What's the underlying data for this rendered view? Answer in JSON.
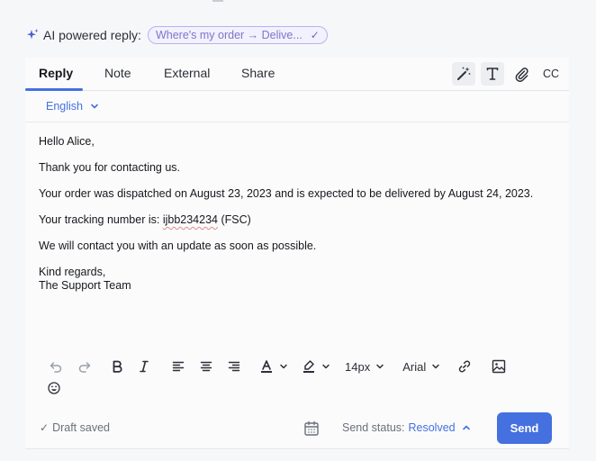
{
  "ai_reply": {
    "label": "AI powered reply:",
    "chip_text": "Where's my order → Delive..."
  },
  "tabs": [
    {
      "label": "Reply",
      "active": true
    },
    {
      "label": "Note",
      "active": false
    },
    {
      "label": "External",
      "active": false
    },
    {
      "label": "Share",
      "active": false
    }
  ],
  "tab_tools": {
    "icons": [
      "magic-wand-icon",
      "text-format-icon",
      "paperclip-icon"
    ],
    "cc_label": "CC"
  },
  "language": {
    "selected": "English"
  },
  "message": {
    "greeting": "Hello Alice,",
    "thanks": "Thank you for contacting us.",
    "dispatch": "Your order was dispatched on August 23, 2023 and is expected to be delivered by August 24, 2023.",
    "tracking_prefix": "Your tracking number is: ",
    "tracking_number": "ijbb234234",
    "tracking_suffix": " (FSC)",
    "update": "We will contact you with an update as soon as possible.",
    "signoff": "Kind regards,",
    "signature": "The Support Team"
  },
  "toolbar": {
    "font_size": "14px",
    "font_family": "Arial"
  },
  "footer": {
    "draft_status": "Draft saved",
    "send_status_label": "Send status:",
    "send_status_value": "Resolved",
    "send_label": "Send"
  },
  "colors": {
    "accent": "#4470e0",
    "ai_chip_border": "#b9b2f0",
    "ai_chip_text": "#7d76c9"
  }
}
